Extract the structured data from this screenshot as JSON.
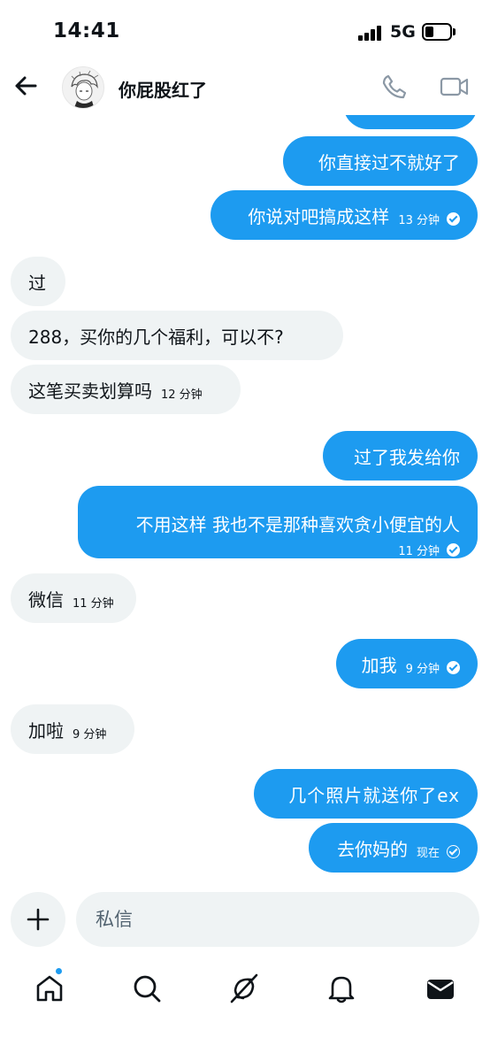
{
  "status_bar": {
    "time": "14:41",
    "network": "5G"
  },
  "header": {
    "title": "你屁股红了"
  },
  "messages": [
    {
      "text": "你直接过不就好了",
      "time": ""
    },
    {
      "text": "你说对吧搞成这样",
      "time": "13 分钟"
    },
    {
      "text": "过",
      "time": ""
    },
    {
      "text": "288，买你的几个福利，可以不?",
      "time": ""
    },
    {
      "text": "这笔买卖划算吗",
      "time": "12 分钟"
    },
    {
      "text": "过了我发给你",
      "time": ""
    },
    {
      "text": "不用这样 我也不是那种喜欢贪小便宜的人",
      "time": "11 分钟"
    },
    {
      "text": "微信",
      "time": "11 分钟"
    },
    {
      "text": "加我",
      "time": "9 分钟"
    },
    {
      "text": "加啦",
      "time": "9 分钟"
    },
    {
      "text": "几个照片就送你了ex",
      "time": ""
    },
    {
      "text": "去你妈的",
      "time": "现在"
    }
  ],
  "composer": {
    "placeholder": "私信"
  },
  "colors": {
    "accent": "#1d9bf0",
    "incoming_bubble": "#eff3f4",
    "text": "#0f1419"
  },
  "icons": [
    "back-arrow-icon",
    "phone-icon",
    "video-icon",
    "plus-icon",
    "home-icon",
    "search-icon",
    "grok-icon",
    "bell-icon",
    "mail-icon"
  ]
}
